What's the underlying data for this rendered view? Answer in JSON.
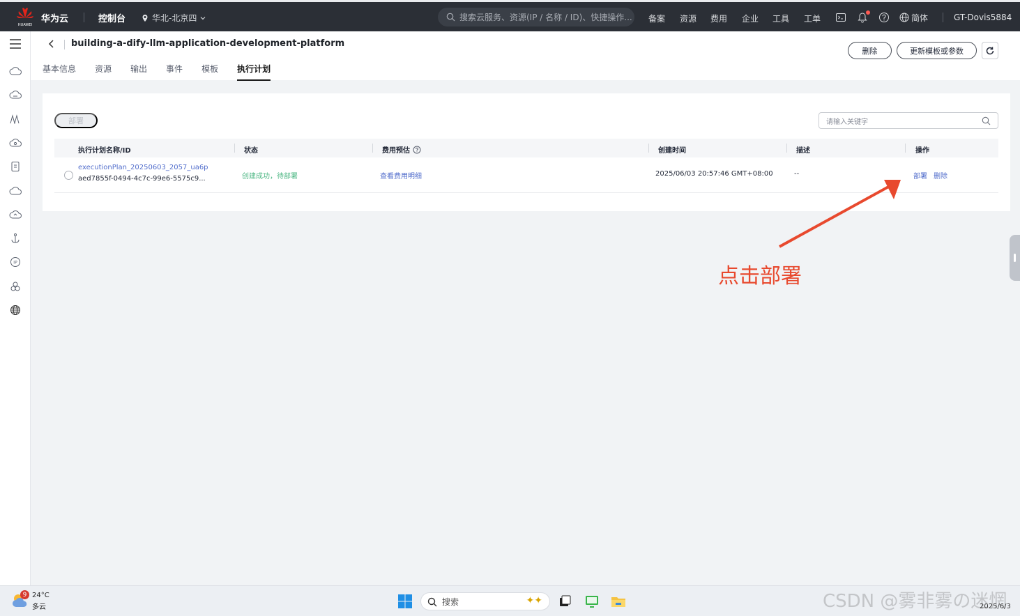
{
  "topbar": {
    "brand": "华为云",
    "console": "控制台",
    "region": "华北-北京四",
    "search_placeholder": "搜索云服务、资源(IP / 名称 / ID)、快捷操作...",
    "nav": [
      "备案",
      "资源",
      "费用",
      "企业",
      "工具",
      "工单"
    ],
    "language": "简体",
    "username": "GT-Dovis5884"
  },
  "header": {
    "title": "building-a-dify-llm-application-development-platform",
    "delete_label": "删除",
    "update_label": "更新模板或参数",
    "tabs": [
      {
        "label": "基本信息",
        "active": false
      },
      {
        "label": "资源",
        "active": false
      },
      {
        "label": "输出",
        "active": false
      },
      {
        "label": "事件",
        "active": false
      },
      {
        "label": "模板",
        "active": false
      },
      {
        "label": "执行计划",
        "active": true
      }
    ]
  },
  "toolbar": {
    "deploy_label": "部署",
    "search_placeholder": "请输入关键字"
  },
  "table": {
    "columns": [
      "执行计划名称/ID",
      "状态",
      "费用预估",
      "创建时间",
      "描述",
      "操作"
    ],
    "rows": [
      {
        "name": "executionPlan_20250603_2057_ua6p",
        "id": "aed7855f-0494-4c7c-99e6-5575c9...",
        "status": "创建成功，待部署",
        "cost": "查看费用明细",
        "created": "2025/06/03 20:57:46 GMT+08:00",
        "description": "--",
        "action_deploy": "部署",
        "action_delete": "删除"
      }
    ]
  },
  "annotation": {
    "text": "点击部署",
    "color": "#e8492e"
  },
  "taskbar": {
    "temperature": "24°C",
    "weather": "多云",
    "weather_badge": "9",
    "search_label": "搜索",
    "watermark": "CSDN @雾非雾の迷惘",
    "date": "2025/6/3"
  },
  "colors": {
    "topbar_bg": "#2b2f36",
    "link": "#526ecc",
    "success": "#50b886",
    "brand_red": "#e1251b"
  }
}
